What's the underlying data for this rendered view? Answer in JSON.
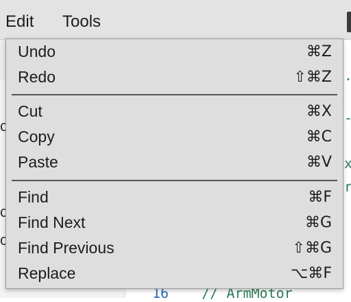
{
  "menubar": {
    "items": [
      {
        "label": "Edit"
      },
      {
        "label": "Tools"
      }
    ]
  },
  "edit_menu": {
    "groups": [
      [
        {
          "label": "Undo",
          "shortcut": "⌘Z"
        },
        {
          "label": "Redo",
          "shortcut": "⇧⌘Z"
        }
      ],
      [
        {
          "label": "Cut",
          "shortcut": "⌘X"
        },
        {
          "label": "Copy",
          "shortcut": "⌘C"
        },
        {
          "label": "Paste",
          "shortcut": "⌘V"
        }
      ],
      [
        {
          "label": "Find",
          "shortcut": "⌘F"
        },
        {
          "label": "Find Next",
          "shortcut": "⌘G"
        },
        {
          "label": "Find Previous",
          "shortcut": "⇧⌘G"
        },
        {
          "label": "Replace",
          "shortcut": "⌥⌘F"
        }
      ]
    ]
  },
  "editor": {
    "visible_line": {
      "number": "16",
      "text": "// ArmMotor"
    },
    "left_fragments": [
      "c",
      "c",
      "c"
    ],
    "right_fragments": [
      ".",
      "-",
      "x",
      "r"
    ]
  }
}
